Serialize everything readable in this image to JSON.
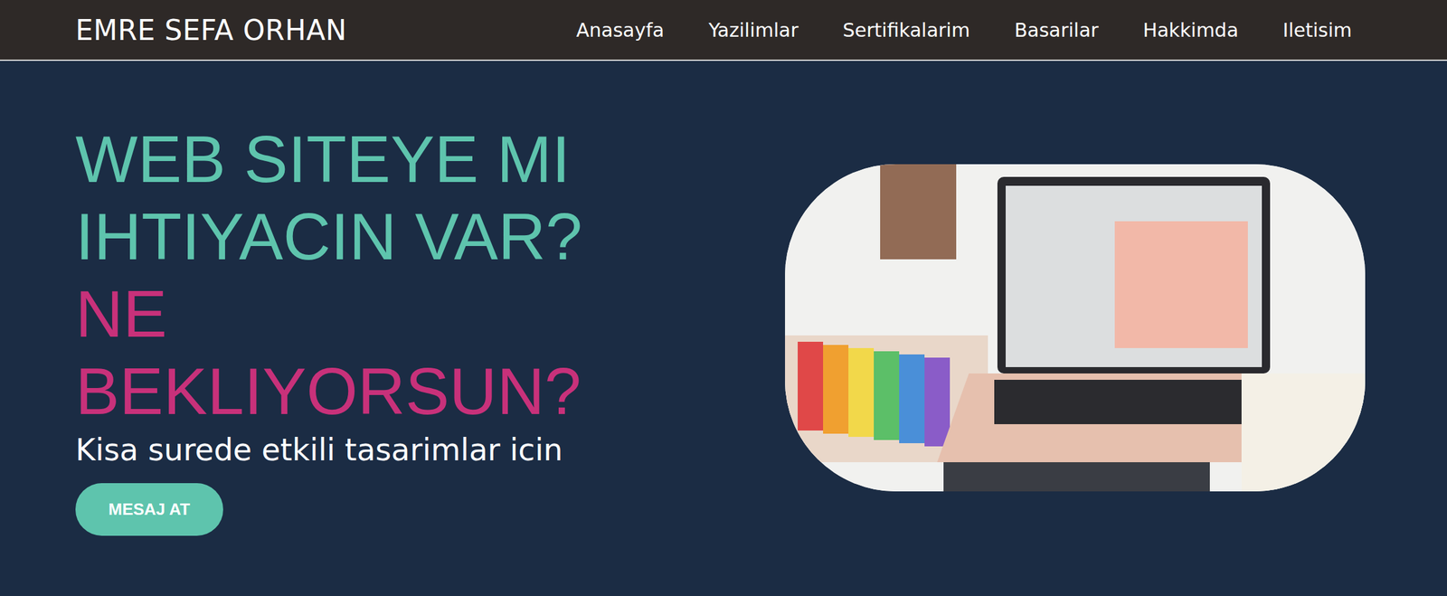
{
  "brand": "EMRE SEFA ORHAN",
  "nav": [
    {
      "label": "Anasayfa"
    },
    {
      "label": "Yazilimlar"
    },
    {
      "label": "Sertifikalarim"
    },
    {
      "label": "Basarilar"
    },
    {
      "label": "Hakkimda"
    },
    {
      "label": "Iletisim"
    }
  ],
  "hero": {
    "headline": [
      {
        "text": "WEB SITEYE MI",
        "color": "#5ec4ad"
      },
      {
        "text": "IHTIYACIN VAR?",
        "color": "#5ec4ad"
      },
      {
        "text": "NE",
        "color": "#c8317a"
      },
      {
        "text": "BEKLIYORSUN?",
        "color": "#c8317a"
      }
    ],
    "subtitle": "Kisa surede etkili tasarimlar icin",
    "button": "MESAJ AT"
  }
}
